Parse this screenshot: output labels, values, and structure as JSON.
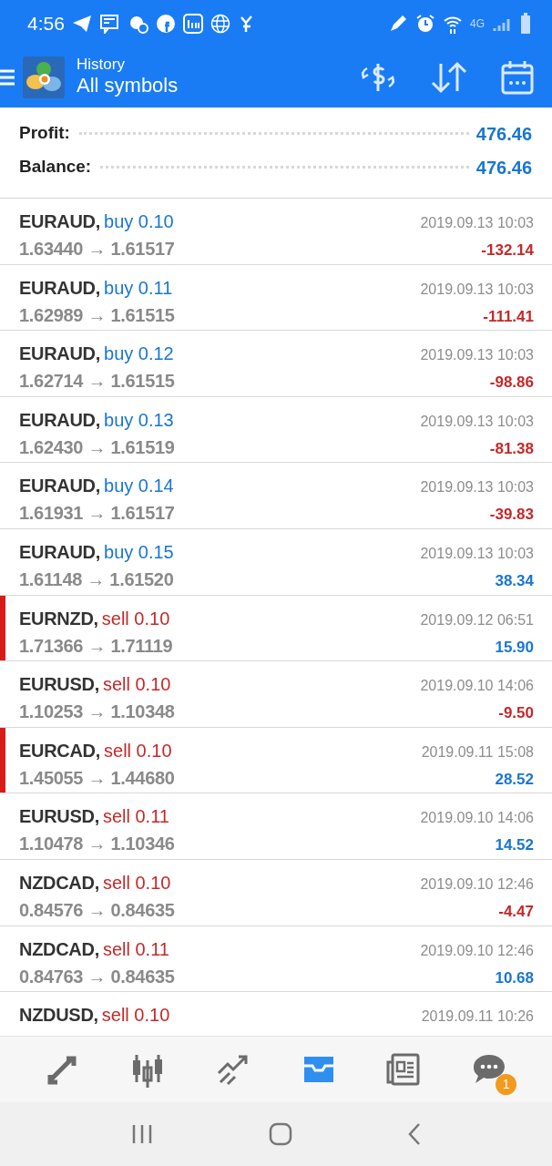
{
  "status_bar": {
    "time": "4:56",
    "network": "4G"
  },
  "app_bar": {
    "title": "History",
    "subtitle": "All symbols"
  },
  "summary": [
    {
      "label": "Profit:",
      "value": "476.46"
    },
    {
      "label": "Balance:",
      "value": "476.46"
    }
  ],
  "deals": [
    {
      "symbol": "EURAUD,",
      "kind": "buy",
      "volume": "buy 0.10",
      "prices": "1.63440 → 1.61517",
      "time": "2019.09.13 10:03",
      "profit": "-132.14",
      "loss": true,
      "marked": false
    },
    {
      "symbol": "EURAUD,",
      "kind": "buy",
      "volume": "buy 0.11",
      "prices": "1.62989 → 1.61515",
      "time": "2019.09.13 10:03",
      "profit": "-111.41",
      "loss": true,
      "marked": false
    },
    {
      "symbol": "EURAUD,",
      "kind": "buy",
      "volume": "buy 0.12",
      "prices": "1.62714 → 1.61515",
      "time": "2019.09.13 10:03",
      "profit": "-98.86",
      "loss": true,
      "marked": false
    },
    {
      "symbol": "EURAUD,",
      "kind": "buy",
      "volume": "buy 0.13",
      "prices": "1.62430 → 1.61519",
      "time": "2019.09.13 10:03",
      "profit": "-81.38",
      "loss": true,
      "marked": false
    },
    {
      "symbol": "EURAUD,",
      "kind": "buy",
      "volume": "buy 0.14",
      "prices": "1.61931 → 1.61517",
      "time": "2019.09.13 10:03",
      "profit": "-39.83",
      "loss": true,
      "marked": false
    },
    {
      "symbol": "EURAUD,",
      "kind": "buy",
      "volume": "buy 0.15",
      "prices": "1.61148 → 1.61520",
      "time": "2019.09.13 10:03",
      "profit": "38.34",
      "loss": false,
      "marked": false
    },
    {
      "symbol": "EURNZD,",
      "kind": "sell",
      "volume": "sell 0.10",
      "prices": "1.71366 → 1.71119",
      "time": "2019.09.12 06:51",
      "profit": "15.90",
      "loss": false,
      "marked": true
    },
    {
      "symbol": "EURUSD,",
      "kind": "sell",
      "volume": "sell 0.10",
      "prices": "1.10253 → 1.10348",
      "time": "2019.09.10 14:06",
      "profit": "-9.50",
      "loss": true,
      "marked": false
    },
    {
      "symbol": "EURCAD,",
      "kind": "sell",
      "volume": "sell 0.10",
      "prices": "1.45055 → 1.44680",
      "time": "2019.09.11 15:08",
      "profit": "28.52",
      "loss": false,
      "marked": true
    },
    {
      "symbol": "EURUSD,",
      "kind": "sell",
      "volume": "sell 0.11",
      "prices": "1.10478 → 1.10346",
      "time": "2019.09.10 14:06",
      "profit": "14.52",
      "loss": false,
      "marked": false
    },
    {
      "symbol": "NZDCAD,",
      "kind": "sell",
      "volume": "sell 0.10",
      "prices": "0.84576 → 0.84635",
      "time": "2019.09.10 12:46",
      "profit": "-4.47",
      "loss": true,
      "marked": false
    },
    {
      "symbol": "NZDCAD,",
      "kind": "sell",
      "volume": "sell 0.11",
      "prices": "0.84763 → 0.84635",
      "time": "2019.09.10 12:46",
      "profit": "10.68",
      "loss": false,
      "marked": false
    },
    {
      "symbol": "NZDUSD,",
      "kind": "sell",
      "volume": "sell 0.10",
      "time": "2019.09.11 10:26",
      "marked": false
    }
  ],
  "bottom_nav": [
    {
      "selected": false
    },
    {
      "selected": false
    },
    {
      "selected": false
    },
    {
      "selected": true
    },
    {
      "selected": false
    },
    {
      "selected": false,
      "badge": "1"
    }
  ]
}
